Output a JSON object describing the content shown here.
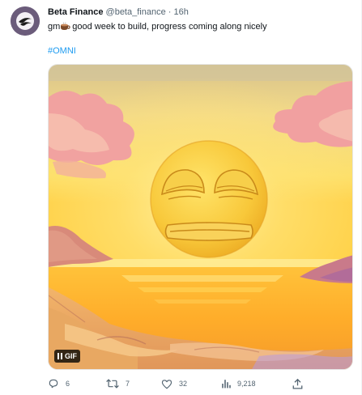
{
  "author": {
    "name": "Beta Finance",
    "handle": "@beta_finance",
    "separator": "·",
    "time": "16h"
  },
  "tweet": {
    "text_prefix": "gm",
    "text": "good week to build, progress coming along nicely",
    "hashtag": "#OMNI"
  },
  "media": {
    "badge_label": "GIF",
    "pause_icon": "pause-icon"
  },
  "actions": {
    "replies": "6",
    "retweets": "7",
    "likes": "32",
    "views": "9,218"
  },
  "colors": {
    "accent": "#1d9bf0",
    "muted": "#536471",
    "text": "#0f1419"
  }
}
